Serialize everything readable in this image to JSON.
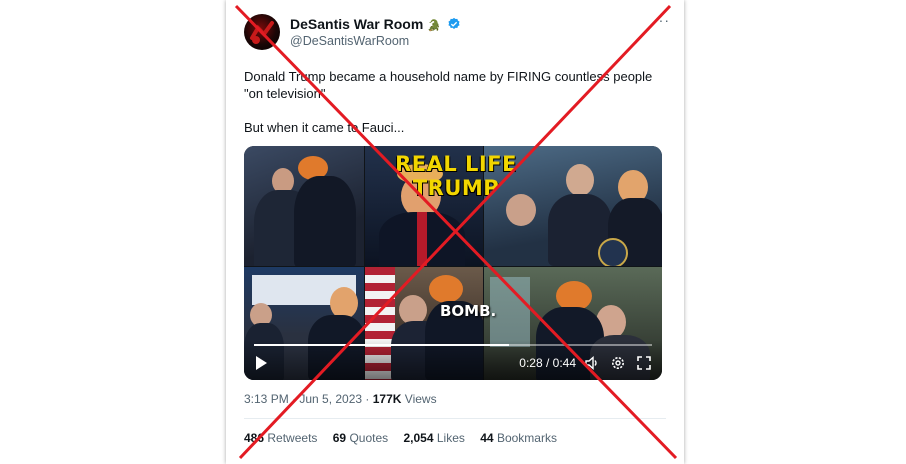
{
  "tweet": {
    "display_name": "DeSantis War Room",
    "emoji": "🐊",
    "handle": "@DeSantisWarRoom",
    "more": "···",
    "text_line1": "Donald Trump became a household name by FIRING countless people \"on television\"",
    "text_line2": "But when it came to Fauci...",
    "timestamp": "3:13 PM · Jun 5, 2023 · ",
    "views_count": "177K",
    "views_label": "Views"
  },
  "video": {
    "overlay_title": "REAL LIFE TRUMP",
    "overlay_caption": "BOMB.",
    "time": "0:28 / 0:44",
    "progress": 0.64
  },
  "stats": [
    {
      "count": "486",
      "label": "Retweets"
    },
    {
      "count": "69",
      "label": "Quotes"
    },
    {
      "count": "2,054",
      "label": "Likes"
    },
    {
      "count": "44",
      "label": "Bookmarks"
    }
  ],
  "colors": {
    "verified": "#1d9bf0",
    "cross": "#e31b23",
    "overlay_title": "#f2d600"
  },
  "icons": [
    "verified-badge-icon",
    "more-icon",
    "play-icon",
    "volume-icon",
    "settings-icon",
    "fullscreen-icon",
    "red-x-mark-icon"
  ]
}
